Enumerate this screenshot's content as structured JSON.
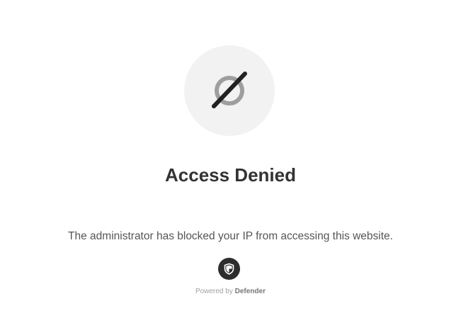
{
  "icons": {
    "blocked": "prohibited-circle-icon",
    "brand": "shield-icon"
  },
  "heading": "Access Denied",
  "message": "The administrator has blocked your IP from accessing this website.",
  "footer": {
    "powered_prefix": "Powered by",
    "brand_name": "Defender"
  },
  "colors": {
    "icon_background": "#f2f2f2",
    "icon_ring": "#9e9e9e",
    "icon_slash": "#222222",
    "heading": "#333333",
    "message": "#555555",
    "badge": "#2d2d2d"
  }
}
